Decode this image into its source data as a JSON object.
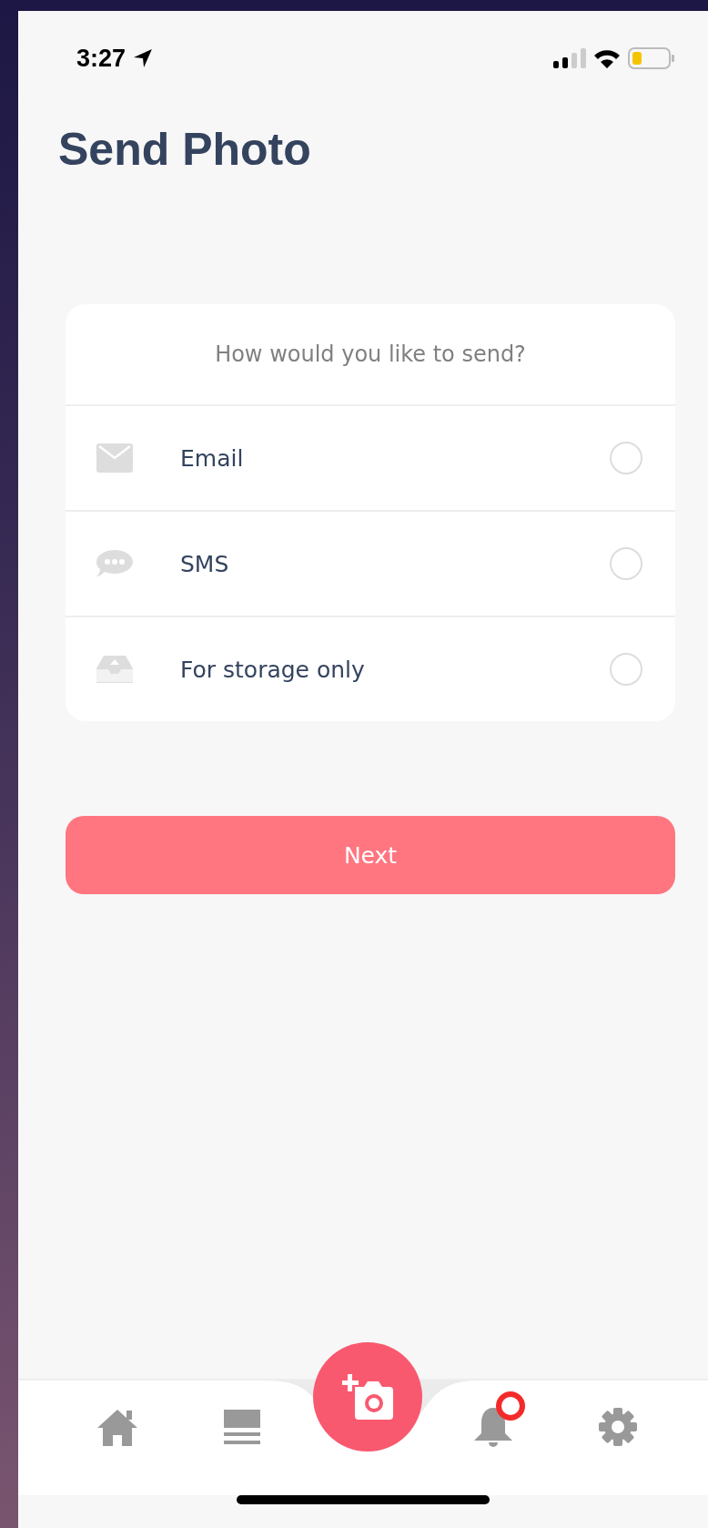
{
  "status_bar": {
    "time": "3:27"
  },
  "title": "Send Photo",
  "send_options": {
    "question": "How would you like to send?",
    "options": [
      {
        "kind": "email",
        "label": "Email",
        "selected": false
      },
      {
        "kind": "sms",
        "label": "SMS",
        "selected": false
      },
      {
        "kind": "storage",
        "label": "For storage only",
        "selected": false
      }
    ]
  },
  "next_button": {
    "label": "Next"
  },
  "tab_bar": {
    "items": [
      {
        "kind": "home",
        "badge": false
      },
      {
        "kind": "list",
        "badge": false
      },
      {
        "kind": "camera",
        "badge": false
      },
      {
        "kind": "notifications",
        "badge": true
      },
      {
        "kind": "settings",
        "badge": false
      }
    ]
  }
}
